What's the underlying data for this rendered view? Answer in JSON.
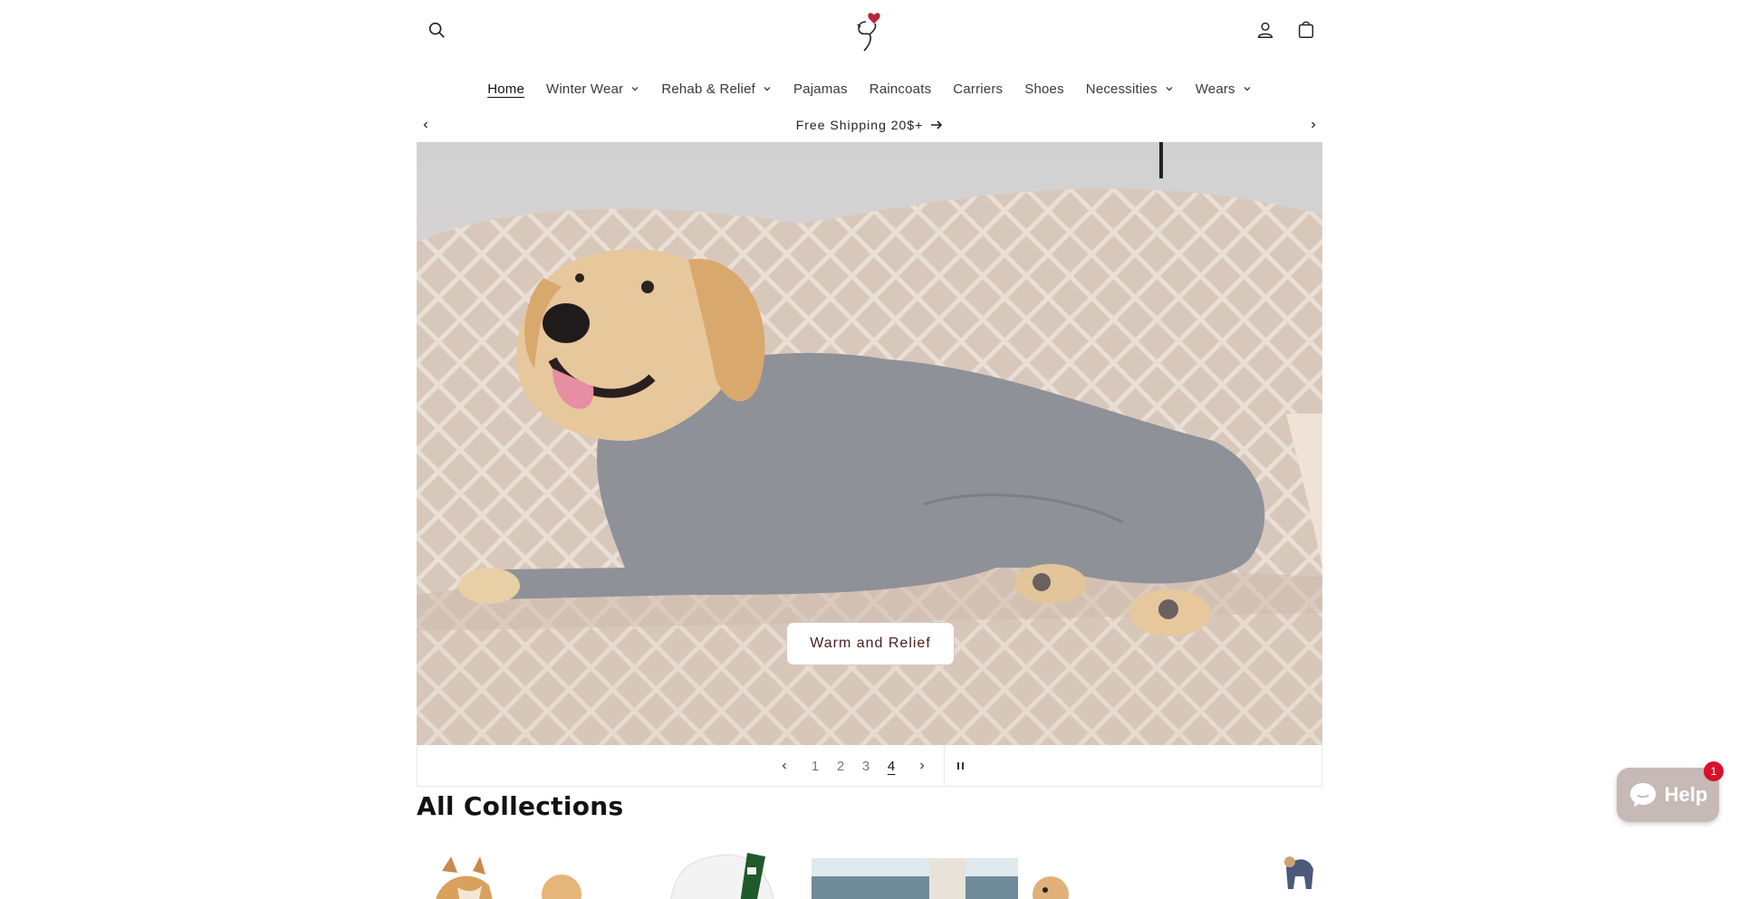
{
  "header": {
    "search_icon": "search-icon",
    "logo": "dog-heart-logo",
    "account_icon": "account-icon",
    "cart_icon": "cart-icon"
  },
  "nav": {
    "items": [
      {
        "label": "Home",
        "active": true,
        "dropdown": false
      },
      {
        "label": "Winter Wear",
        "active": false,
        "dropdown": true
      },
      {
        "label": "Rehab & Relief",
        "active": false,
        "dropdown": true
      },
      {
        "label": "Pajamas",
        "active": false,
        "dropdown": false
      },
      {
        "label": "Raincoats",
        "active": false,
        "dropdown": false
      },
      {
        "label": "Carriers",
        "active": false,
        "dropdown": false
      },
      {
        "label": "Shoes",
        "active": false,
        "dropdown": false
      },
      {
        "label": "Necessities",
        "active": false,
        "dropdown": true
      },
      {
        "label": "Wears",
        "active": false,
        "dropdown": true
      }
    ]
  },
  "announcement": {
    "text": "Free Shipping 20$+"
  },
  "hero": {
    "button_label": "Warm and Relief"
  },
  "slider": {
    "slides": [
      "1",
      "2",
      "3",
      "4"
    ],
    "current": "4"
  },
  "collections": {
    "title": "All Collections"
  },
  "chat": {
    "label": "Help",
    "badge": "1"
  },
  "colors": {
    "accent": "#4b1c1c",
    "chat_bg": "#c7b9b5",
    "badge": "#d6112a"
  }
}
